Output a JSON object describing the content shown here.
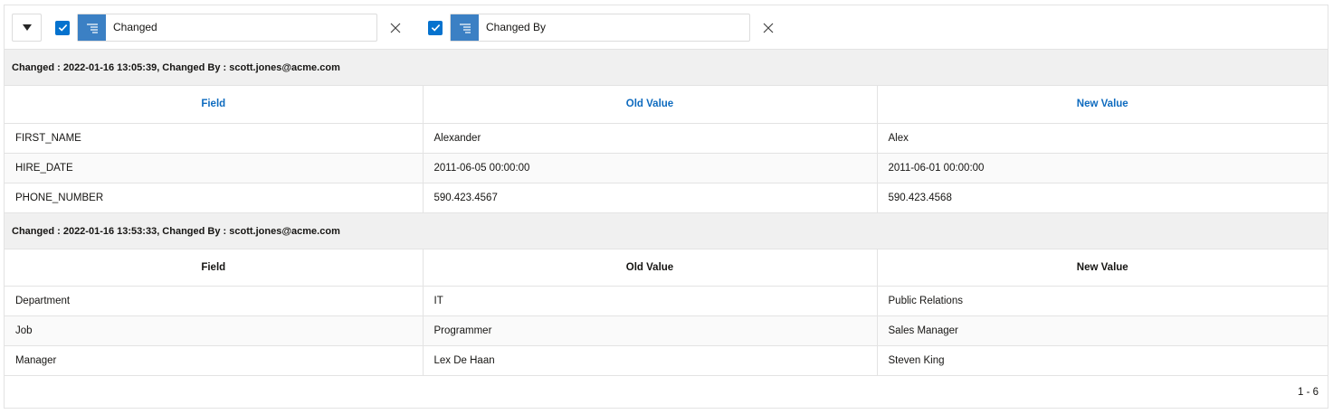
{
  "toolbar": {
    "control_breaks": [
      {
        "label": "Changed",
        "checked": true
      },
      {
        "label": "Changed By",
        "checked": true
      }
    ]
  },
  "groups": [
    {
      "header": "Changed : 2022-01-16 13:05:39, Changed By : scott.jones@acme.com",
      "headers_are_links": true,
      "columns": [
        "Field",
        "Old Value",
        "New Value"
      ],
      "rows": [
        [
          "FIRST_NAME",
          "Alexander",
          "Alex"
        ],
        [
          "HIRE_DATE",
          "2011-06-05 00:00:00",
          "2011-06-01 00:00:00"
        ],
        [
          "PHONE_NUMBER",
          "590.423.4567",
          "590.423.4568"
        ]
      ]
    },
    {
      "header": "Changed : 2022-01-16 13:53:33, Changed By : scott.jones@acme.com",
      "headers_are_links": false,
      "columns": [
        "Field",
        "Old Value",
        "New Value"
      ],
      "rows": [
        [
          "Department",
          "IT",
          "Public Relations"
        ],
        [
          "Job",
          "Programmer",
          "Sales Manager"
        ],
        [
          "Manager",
          "Lex De Haan",
          "Steven King"
        ]
      ]
    }
  ],
  "pagination": "1 - 6",
  "colors": {
    "accent": "#0572ce",
    "control_break_icon": "#3b80c4",
    "header_link": "#0e6bbf",
    "group_bg": "#f0f0f0"
  }
}
